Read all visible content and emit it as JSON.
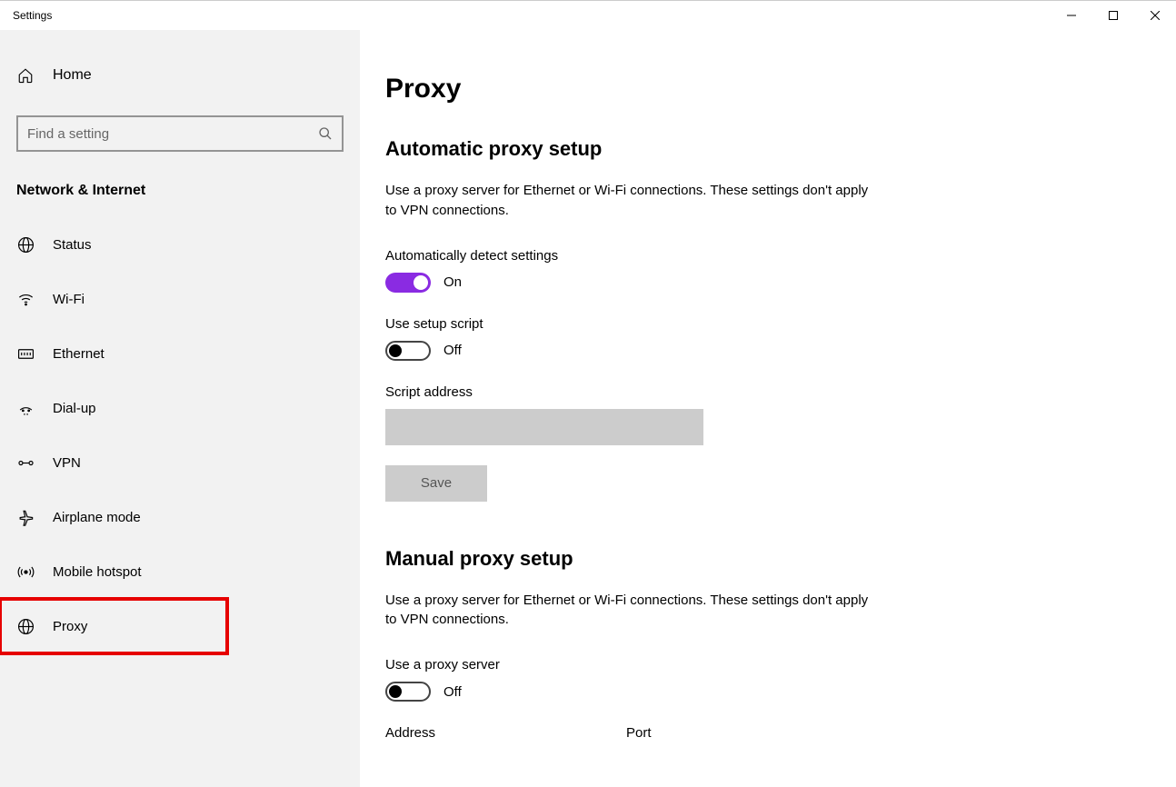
{
  "titlebar": {
    "title": "Settings"
  },
  "sidebar": {
    "home_label": "Home",
    "search_placeholder": "Find a setting",
    "category": "Network & Internet",
    "items": [
      {
        "label": "Status"
      },
      {
        "label": "Wi-Fi"
      },
      {
        "label": "Ethernet"
      },
      {
        "label": "Dial-up"
      },
      {
        "label": "VPN"
      },
      {
        "label": "Airplane mode"
      },
      {
        "label": "Mobile hotspot"
      },
      {
        "label": "Proxy"
      }
    ]
  },
  "content": {
    "page_title": "Proxy",
    "auto": {
      "heading": "Automatic proxy setup",
      "desc": "Use a proxy server for Ethernet or Wi-Fi connections. These settings don't apply to VPN connections.",
      "auto_detect_label": "Automatically detect settings",
      "auto_detect_state": "On",
      "use_script_label": "Use setup script",
      "use_script_state": "Off",
      "script_address_label": "Script address",
      "script_address_value": "",
      "save_label": "Save"
    },
    "manual": {
      "heading": "Manual proxy setup",
      "desc": "Use a proxy server for Ethernet or Wi-Fi connections. These settings don't apply to VPN connections.",
      "use_proxy_label": "Use a proxy server",
      "use_proxy_state": "Off",
      "address_label": "Address",
      "port_label": "Port"
    }
  }
}
